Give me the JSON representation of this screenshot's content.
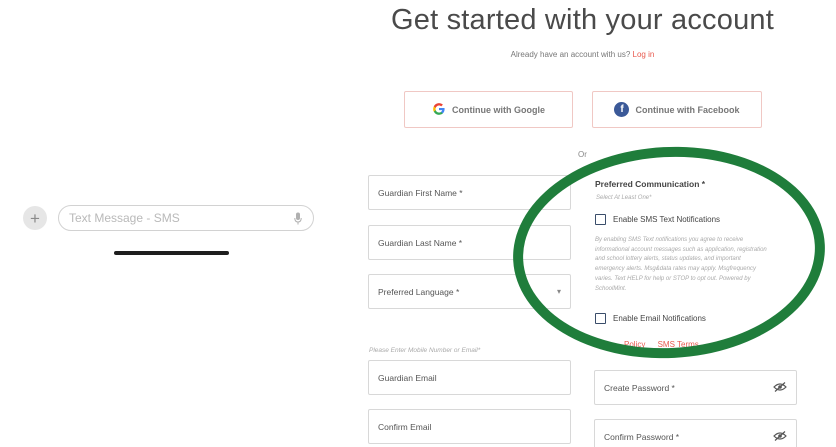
{
  "sms": {
    "placeholder": "Text Message - SMS",
    "plus_glyph": "+"
  },
  "form": {
    "title": "Get started with your account",
    "login_prompt": "Already have an account with us?",
    "login_link": "Log in",
    "google_label": "Continue with Google",
    "facebook_label": "Continue with Facebook",
    "or_label": "Or",
    "fields": {
      "first_name": "Guardian First Name *",
      "last_name": "Guardian Last Name *",
      "language": "Preferred Language *",
      "email_hint": "Please Enter Mobile Number or Email*",
      "email": "Guardian Email",
      "confirm_email": "Confirm Email",
      "create_password": "Create Password *",
      "confirm_password": "Confirm Password *"
    },
    "communication": {
      "title": "Preferred Communication *",
      "subtitle": "Select At Least One*",
      "sms_option": "Enable SMS Text Notifications",
      "sms_disclaimer": "By enabling SMS Text notifications you agree to receive informational account messages such as application, registration and school lottery alerts, status updates, and important emergency alerts. Msg&data rates may apply. Msgfrequency varies. Text HELP for help or STOP to opt out. Powered by SchoolMint.",
      "email_option": "Enable Email Notifications",
      "policy_link": "Policy",
      "sms_terms_link": "SMS Terms"
    }
  },
  "colors": {
    "accent": "#e85a4f",
    "annotation": "#1f7d3b",
    "facebook": "#3b5998"
  }
}
